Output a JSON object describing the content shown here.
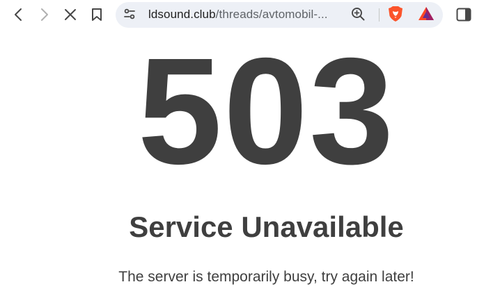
{
  "browser": {
    "url_host": "ldsound.club",
    "url_path": "/threads/avtomobil-...",
    "back_icon": "chevron-left-icon",
    "forward_icon": "chevron-right-icon",
    "stop_icon": "close-icon",
    "bookmark_icon": "bookmark-icon",
    "site_info_icon": "tune-icon",
    "zoom_icon": "zoom-in-icon",
    "brave_shield_icon": "brave-lion-icon",
    "rewards_icon": "bat-triangle-icon",
    "sidebar_icon": "sidebar-icon",
    "colors": {
      "brave_orange": "#fb542b",
      "bat_purple": "#662d91",
      "bat_orange": "#ff4724"
    }
  },
  "page": {
    "error_code": "503",
    "heading": "Service Unavailable",
    "message": "The server is temporarily busy, try again later!",
    "text_color": "#3f3f3f"
  }
}
